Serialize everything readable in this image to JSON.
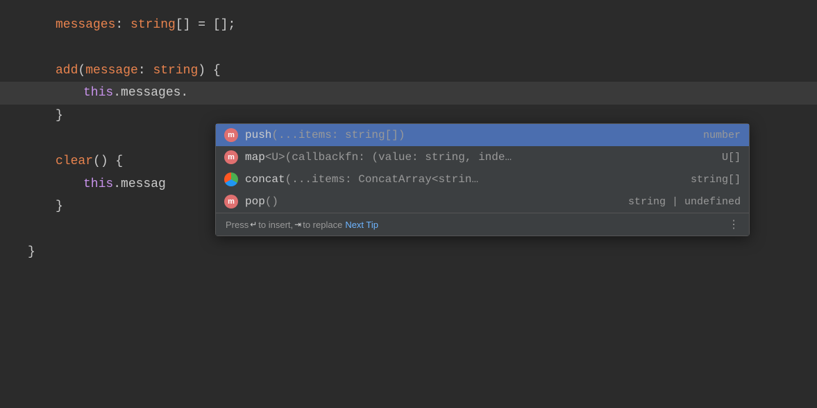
{
  "editor": {
    "background": "#2b2b2b",
    "lines": [
      {
        "id": "line1",
        "indent": 1,
        "tokens": [
          {
            "text": "messages",
            "class": "kw-orange"
          },
          {
            "text": ": ",
            "class": "plain"
          },
          {
            "text": "string",
            "class": "string-type"
          },
          {
            "text": "[] = [];",
            "class": "plain"
          }
        ]
      },
      {
        "id": "line2",
        "indent": 0,
        "tokens": []
      },
      {
        "id": "line3",
        "indent": 1,
        "tokens": [
          {
            "text": "add",
            "class": "method-orange"
          },
          {
            "text": "(",
            "class": "plain"
          },
          {
            "text": "message",
            "class": "kw-orange"
          },
          {
            "text": ": ",
            "class": "plain"
          },
          {
            "text": "string",
            "class": "string-type"
          },
          {
            "text": ") {",
            "class": "plain"
          }
        ]
      },
      {
        "id": "line4",
        "indent": 2,
        "highlighted": true,
        "tokens": [
          {
            "text": "this",
            "class": "this-kw"
          },
          {
            "text": ".messages.",
            "class": "plain"
          }
        ]
      },
      {
        "id": "line5",
        "indent": 1,
        "tokens": [
          {
            "text": "}",
            "class": "brace"
          }
        ]
      },
      {
        "id": "line6",
        "indent": 0,
        "tokens": []
      },
      {
        "id": "line7",
        "indent": 1,
        "tokens": [
          {
            "text": "clear",
            "class": "method-orange"
          },
          {
            "text": "() {",
            "class": "plain"
          }
        ]
      },
      {
        "id": "line8",
        "indent": 2,
        "tokens": [
          {
            "text": "this",
            "class": "this-kw"
          },
          {
            "text": ".messag",
            "class": "plain"
          }
        ]
      },
      {
        "id": "line9",
        "indent": 1,
        "tokens": [
          {
            "text": "}",
            "class": "brace"
          }
        ]
      },
      {
        "id": "line10",
        "indent": 0,
        "tokens": []
      },
      {
        "id": "line11",
        "indent": 0,
        "tokens": [
          {
            "text": "}",
            "class": "brace"
          }
        ]
      }
    ]
  },
  "autocomplete": {
    "items": [
      {
        "id": "item-push",
        "icon_type": "m",
        "icon_class": "ac-icon-m",
        "label": "push(...items: string[])",
        "type_label": "number",
        "selected": true
      },
      {
        "id": "item-map",
        "icon_type": "m",
        "icon_class": "ac-icon-m",
        "label": "map<U>(callbackfn: (value: string, inde…",
        "type_label": "U[]",
        "selected": false
      },
      {
        "id": "item-concat",
        "icon_type": "concat",
        "icon_class": "ac-icon-concat",
        "label": "concat(...items: ConcatArray<strin…",
        "type_label": "string[]",
        "selected": false
      },
      {
        "id": "item-pop",
        "icon_type": "m",
        "icon_class": "ac-icon-m",
        "label": "pop()",
        "type_label": "string | undefined",
        "selected": false
      }
    ],
    "footer": {
      "press_label": "Press",
      "insert_key": "↵",
      "insert_text": "to insert,",
      "replace_key": "⇥",
      "replace_text": "to replace",
      "next_tip_label": "Next Tip",
      "more_icon": "⋮"
    }
  }
}
